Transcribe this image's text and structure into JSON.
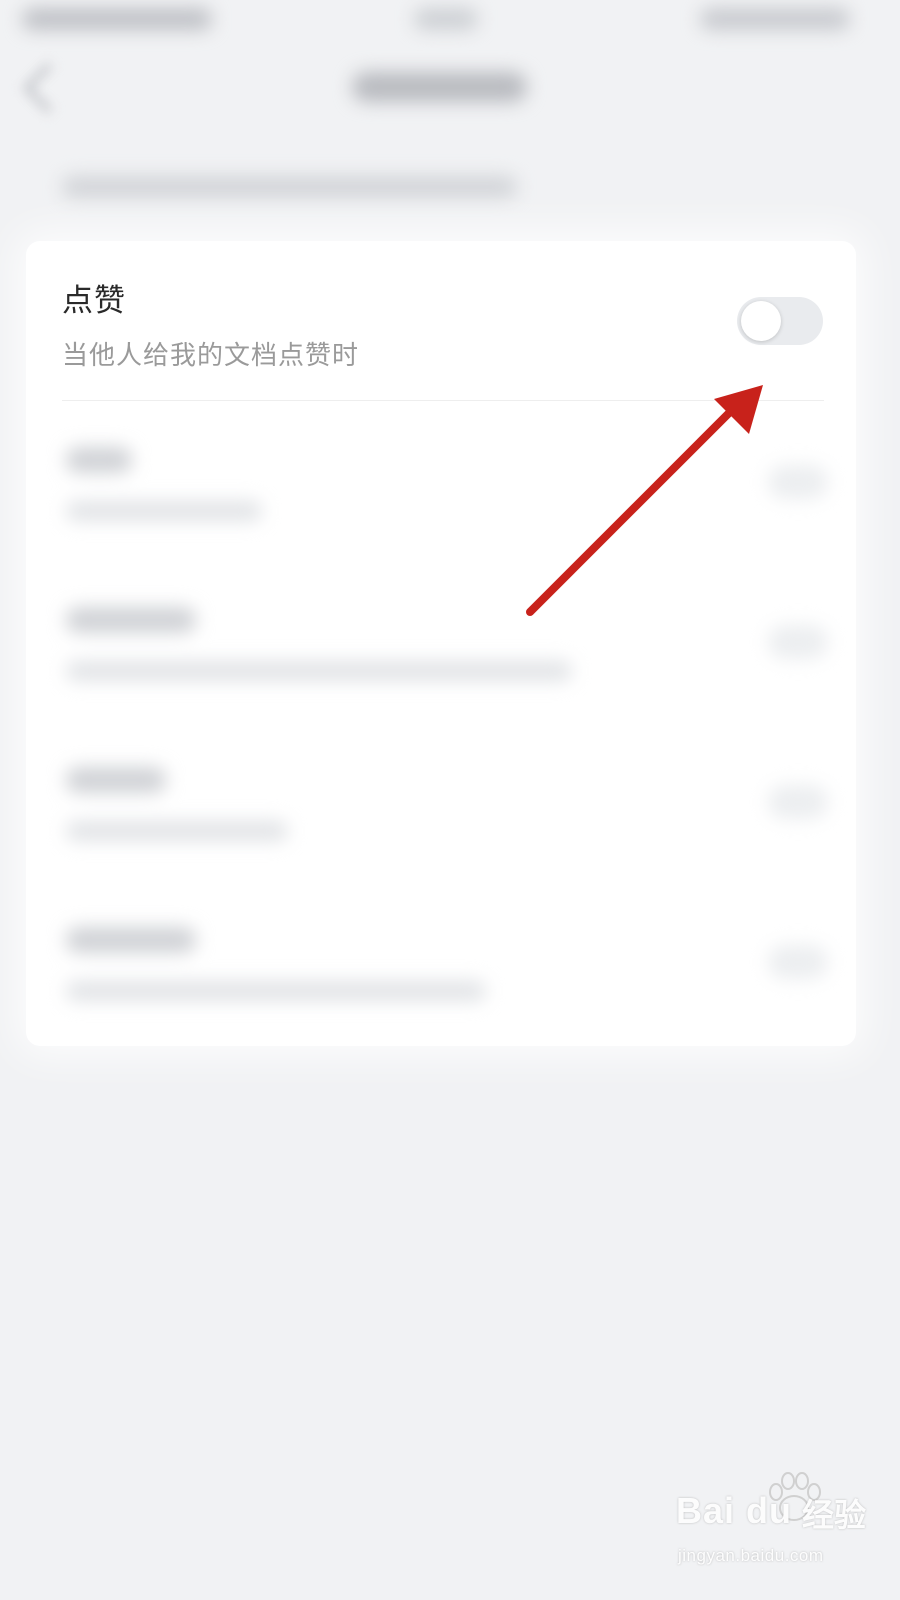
{
  "setting": {
    "title": "点赞",
    "description": "当他人给我的文档点赞时",
    "toggle_state": "off"
  },
  "watermark": {
    "logo": "Bai du",
    "cn": "经验",
    "url": "jingyan.baidu.com"
  },
  "colors": {
    "background": "#f1f2f4",
    "card": "#ffffff",
    "arrow": "#c8221b",
    "toggle_off": "#e9ebee"
  }
}
